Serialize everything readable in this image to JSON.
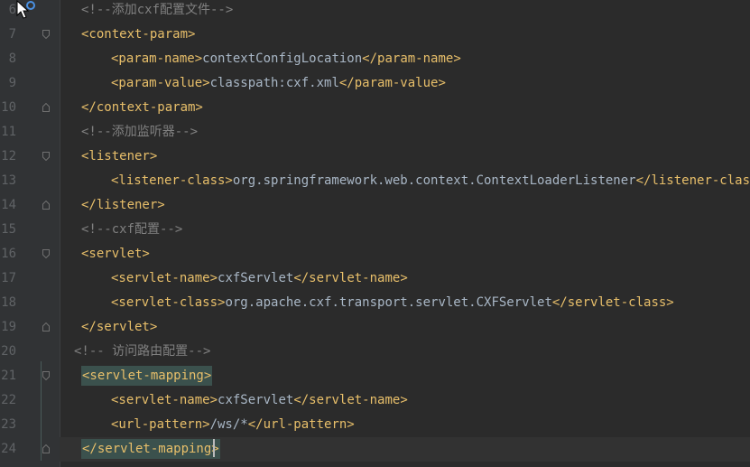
{
  "editor": {
    "lines": [
      {
        "no": "6",
        "indent": 1,
        "kind": "comment",
        "text": "<!--添加cxf配置文件-->",
        "fold": false
      },
      {
        "no": "7",
        "indent": 1,
        "kind": "open",
        "tag": "<context-param>",
        "fold": true
      },
      {
        "no": "8",
        "indent": 2,
        "kind": "element",
        "open": "<param-name>",
        "value": "contextConfigLocation",
        "close": "</param-name>",
        "fold": false
      },
      {
        "no": "9",
        "indent": 2,
        "kind": "element",
        "open": "<param-value>",
        "value": "classpath:cxf.xml",
        "close": "</param-value>",
        "fold": false
      },
      {
        "no": "10",
        "indent": 1,
        "kind": "close",
        "tag": "</context-param>",
        "fold": true
      },
      {
        "no": "11",
        "indent": 1,
        "kind": "comment",
        "text": "<!--添加监听器-->",
        "fold": false
      },
      {
        "no": "12",
        "indent": 1,
        "kind": "open",
        "tag": "<listener>",
        "fold": true
      },
      {
        "no": "13",
        "indent": 2,
        "kind": "element",
        "open": "<listener-class>",
        "value": "org.springframework.web.context.ContextLoaderListener",
        "close": "</listener-class>",
        "fold": false
      },
      {
        "no": "14",
        "indent": 1,
        "kind": "close",
        "tag": "</listener>",
        "fold": true
      },
      {
        "no": "15",
        "indent": 1,
        "kind": "comment",
        "text": "<!--cxf配置-->",
        "fold": false
      },
      {
        "no": "16",
        "indent": 1,
        "kind": "open",
        "tag": "<servlet>",
        "fold": true
      },
      {
        "no": "17",
        "indent": 2,
        "kind": "element",
        "open": "<servlet-name>",
        "value": "cxfServlet",
        "close": "</servlet-name>",
        "fold": false
      },
      {
        "no": "18",
        "indent": 2,
        "kind": "element",
        "open": "<servlet-class>",
        "value": "org.apache.cxf.transport.servlet.CXFServlet",
        "close": "</servlet-class>",
        "fold": false
      },
      {
        "no": "19",
        "indent": 1,
        "kind": "close",
        "tag": "</servlet>",
        "fold": true
      },
      {
        "no": "20",
        "indent": 0,
        "kind": "comment",
        "text": "<!-- 访问路由配置-->",
        "fold": false
      },
      {
        "no": "21",
        "indent": 1,
        "kind": "open",
        "tag": "<servlet-mapping>",
        "fold": true,
        "highlight": true
      },
      {
        "no": "22",
        "indent": 2,
        "kind": "element",
        "open": "<servlet-name>",
        "value": "cxfServlet",
        "close": "</servlet-name>",
        "fold": false
      },
      {
        "no": "23",
        "indent": 2,
        "kind": "element",
        "open": "<url-pattern>",
        "value": "/ws/*",
        "close": "</url-pattern>",
        "fold": false
      },
      {
        "no": "24",
        "indent": 1,
        "kind": "close",
        "tag": "</servlet-mapping>",
        "fold": true,
        "highlight": true,
        "current": true
      }
    ]
  },
  "colors": {
    "background": "#2b2b2b",
    "gutter": "#313335",
    "tag": "#e8bf6a",
    "text": "#a9b7c6",
    "comment": "#808080",
    "line_number": "#606366",
    "match_highlight": "#3b514d"
  },
  "icons": {
    "cursor": "mouse-pointer-icon",
    "fold": "fold-marker-icon"
  }
}
